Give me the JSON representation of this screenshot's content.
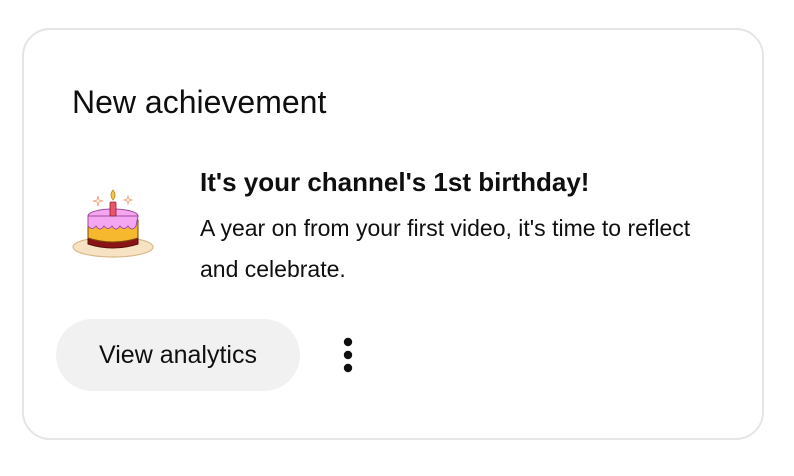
{
  "card": {
    "title": "New achievement",
    "achievement": {
      "icon": "birthday-cake-icon",
      "title": "It's your channel's 1st birthday!",
      "description": "A year on from your first video, it's time to reflect and celebrate."
    },
    "actions": {
      "primary_label": "View analytics",
      "more_icon": "more-vertical-icon"
    }
  },
  "colors": {
    "card_border": "#e5e5e5",
    "button_bg": "#f1f1f1",
    "text": "#0f0f0f",
    "cake_frosting": "#f4a6f0",
    "cake_base": "#f5b82e",
    "cake_bottom": "#8a1414",
    "plate": "#f7e3c4"
  }
}
